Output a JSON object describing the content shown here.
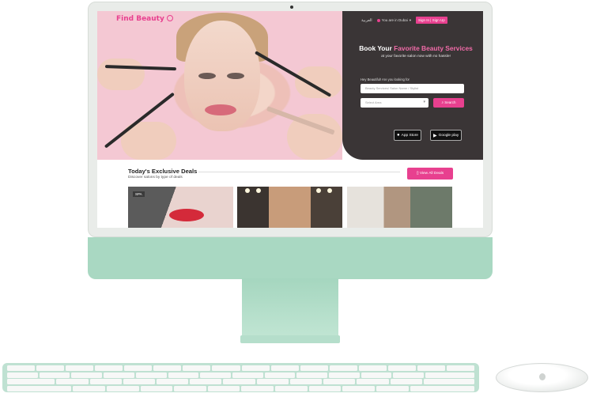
{
  "header": {
    "logo": "Find Beauty",
    "lang": "العربية",
    "location": "You are in Dubai",
    "signin": "Sign In | Sign Up"
  },
  "hero": {
    "headline_plain": "Book Your",
    "headline_accent": "Favorite Beauty Services",
    "subline": "at your favorite salon now with no hassle!",
    "ask": "Hey Beautiful! Are you looking for",
    "search_placeholder": "Beauty Services/ Salon Name / Stylist",
    "area_placeholder": "Select Area",
    "search_button": "Search",
    "app_store": "App Store",
    "google_play": "Google play"
  },
  "deals": {
    "title": "Today's Exclusive Deals",
    "subtitle": "Discover salons by type of deals",
    "view_all": "View All Deals",
    "badge": "SPA"
  },
  "colors": {
    "accent": "#e8408f",
    "panel": "#3a3536",
    "imac": "#a9d8c2"
  }
}
